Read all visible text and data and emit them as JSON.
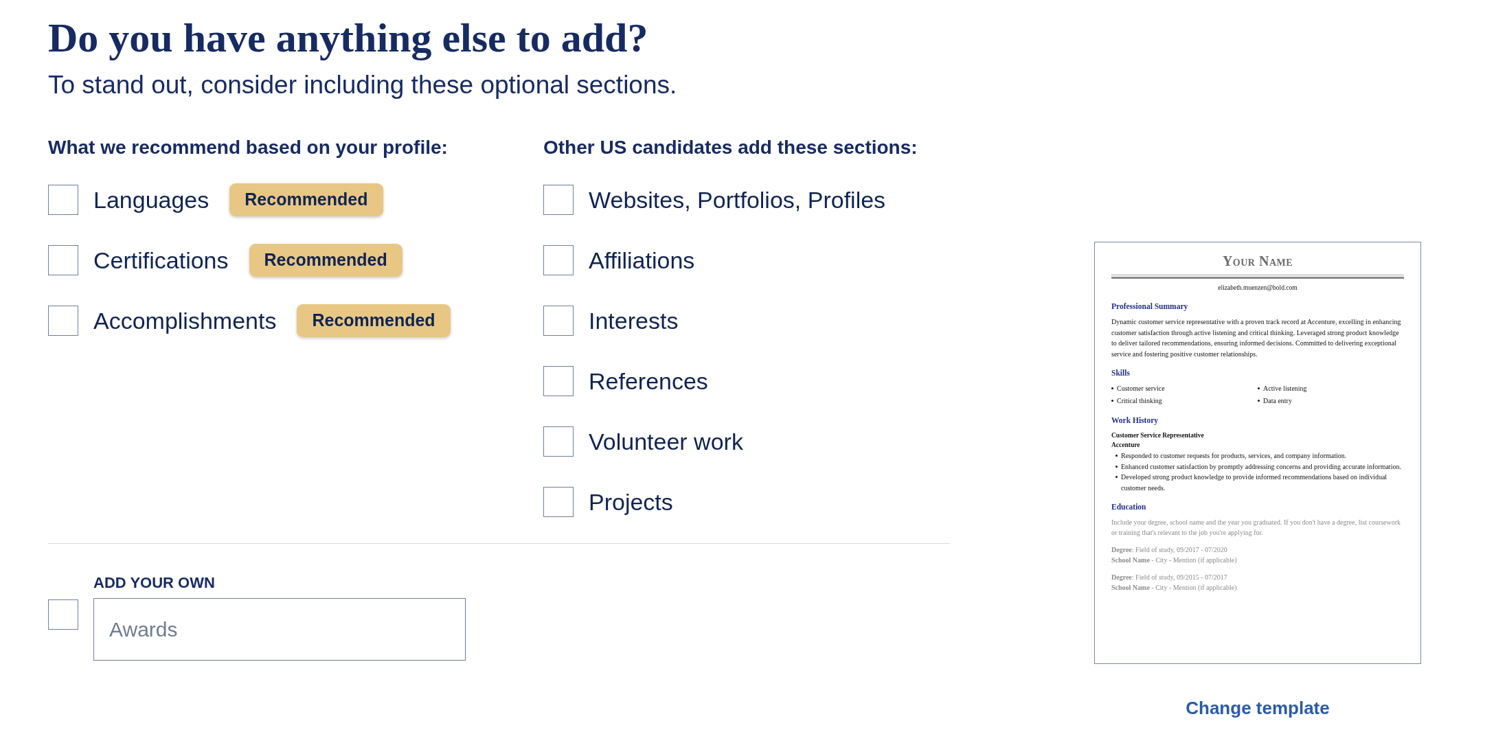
{
  "heading": "Do you have anything else to add?",
  "subheading": "To stand out, consider including these optional sections.",
  "recommended": {
    "title": "What we recommend based on your profile:",
    "items": [
      {
        "label": "Languages",
        "checked": false,
        "badge": "Recommended"
      },
      {
        "label": "Certifications",
        "checked": false,
        "badge": "Recommended"
      },
      {
        "label": "Accomplishments",
        "checked": false,
        "badge": "Recommended"
      }
    ]
  },
  "others": {
    "title": "Other US candidates add these sections:",
    "items": [
      {
        "label": "Websites, Portfolios, Profiles",
        "checked": false
      },
      {
        "label": "Affiliations",
        "checked": false
      },
      {
        "label": "Interests",
        "checked": false
      },
      {
        "label": "References",
        "checked": false
      },
      {
        "label": "Volunteer work",
        "checked": false
      },
      {
        "label": "Projects",
        "checked": false
      }
    ]
  },
  "add_your_own": {
    "label": "ADD YOUR OWN",
    "checked": false,
    "placeholder": "Awards"
  },
  "preview": {
    "name": "Your Name",
    "email": "elizabeth.muenzen@bold.com",
    "sections": [
      {
        "kind": "summary",
        "title": "Professional Summary",
        "text": "Dynamic customer service representative with a proven track record at Accenture, excelling in enhancing customer satisfaction through active listening and critical thinking. Leveraged strong product knowledge to deliver tailored recommendations, ensuring informed decisions. Committed to delivering exceptional service and fostering positive customer relationships."
      },
      {
        "kind": "skills",
        "title": "Skills",
        "items": [
          "Customer service",
          "Active listening",
          "Critical thinking",
          "Data entry"
        ]
      },
      {
        "kind": "work",
        "title": "Work History",
        "job_title": "Customer Service Representative",
        "company": "Accenture",
        "bullets": [
          "Responded to customer requests for products, services, and company information.",
          "Enhanced customer satisfaction by promptly addressing concerns and providing accurate information.",
          "Developed strong product knowledge to provide informed recommendations based on individual customer needs."
        ]
      },
      {
        "kind": "education",
        "title": "Education",
        "hint": "Include your degree, school name and the year you graduated. If you don't have a degree, list coursework or training that's relevant to the job you're applying for.",
        "entries": [
          {
            "degree": "**Degree**: Field of study, 09/2017 - 07/2020",
            "school": "**School Name** - City - Mention (if applicable)"
          },
          {
            "degree": "**Degree**: Field of study, 09/2015 - 07/2017",
            "school": "**School Name** - City - Mention (if applicable)"
          }
        ]
      }
    ]
  },
  "change_template": "Change template"
}
